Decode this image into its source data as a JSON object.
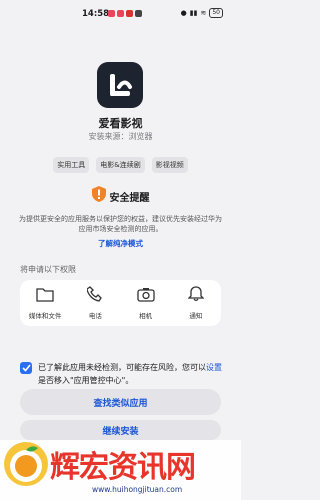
{
  "status": {
    "time": "14:58",
    "battery": "50"
  },
  "app": {
    "name": "爱看影视",
    "source": "安装来源：浏览器"
  },
  "tags": [
    "实用工具",
    "电影&连续剧",
    "影视视频"
  ],
  "security": {
    "title": "安全提醒",
    "description": "为提供更安全的应用服务以保护您的权益，建议优先安装经过华为应用市场安全检测的应用。",
    "link": "了解纯净模式"
  },
  "permissions": {
    "title": "将申请以下权限",
    "items": [
      {
        "label": "媒体和文件",
        "icon": "folder-icon"
      },
      {
        "label": "电话",
        "icon": "phone-icon"
      },
      {
        "label": "相机",
        "icon": "camera-icon"
      },
      {
        "label": "通知",
        "icon": "bell-icon"
      }
    ]
  },
  "consent": {
    "text_before": "已了解此应用未经检测，可能存在风险，您可以",
    "link": "设置",
    "text_after": "是否移入\"应用管控中心\"。"
  },
  "buttons": {
    "find_similar": "查找类似应用",
    "continue": "继续安装"
  },
  "watermark": {
    "text": "辉宏资讯网",
    "url": "www.huihongjituan.com"
  },
  "colors": {
    "accent": "#1a56d6",
    "warning": "#f0822a",
    "checkbox": "#2c6ef2"
  }
}
